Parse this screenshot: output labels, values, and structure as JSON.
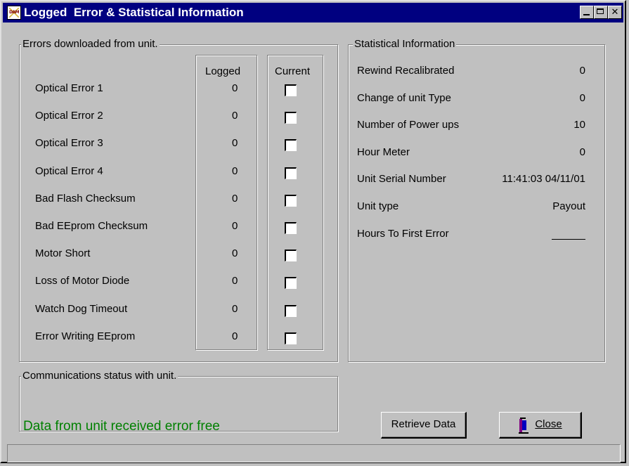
{
  "window": {
    "title": "Logged  Error & Statistical Information",
    "app_icon_text": "DAM"
  },
  "errors_group": {
    "label": "Errors downloaded from unit.",
    "col_logged": "Logged",
    "col_current": "Current",
    "rows": [
      {
        "name": "Optical Error  1",
        "logged": "0",
        "current": false
      },
      {
        "name": "Optical Error  2",
        "logged": "0",
        "current": false
      },
      {
        "name": "Optical Error  3",
        "logged": "0",
        "current": false
      },
      {
        "name": "Optical Error  4",
        "logged": "0",
        "current": false
      },
      {
        "name": "Bad Flash Checksum",
        "logged": "0",
        "current": false
      },
      {
        "name": "Bad EEprom Checksum",
        "logged": "0",
        "current": false
      },
      {
        "name": "Motor Short",
        "logged": "0",
        "current": false
      },
      {
        "name": "Loss of Motor Diode",
        "logged": "0",
        "current": false
      },
      {
        "name": "Watch Dog Timeout",
        "logged": "0",
        "current": false
      },
      {
        "name": "Error Writing EEprom",
        "logged": "0",
        "current": false
      }
    ]
  },
  "stats_group": {
    "label": "Statistical Information",
    "rows": [
      {
        "label": "Rewind Recalibrated",
        "value": "0"
      },
      {
        "label": "Change of unit Type",
        "value": "0"
      },
      {
        "label": "Number of Power ups",
        "value": "10"
      },
      {
        "label": "Hour Meter",
        "value": "0"
      },
      {
        "label": "Unit Serial Number",
        "value": "11:41:03  04/11/01"
      },
      {
        "label": "Unit type",
        "value": "Payout"
      },
      {
        "label": "Hours To First Error",
        "value": ""
      }
    ]
  },
  "comm_group": {
    "label": "Communications status with unit.",
    "status": "Data from unit received error free",
    "status_color": "#008000"
  },
  "buttons": {
    "retrieve": "Retrieve Data",
    "close": "Close"
  }
}
